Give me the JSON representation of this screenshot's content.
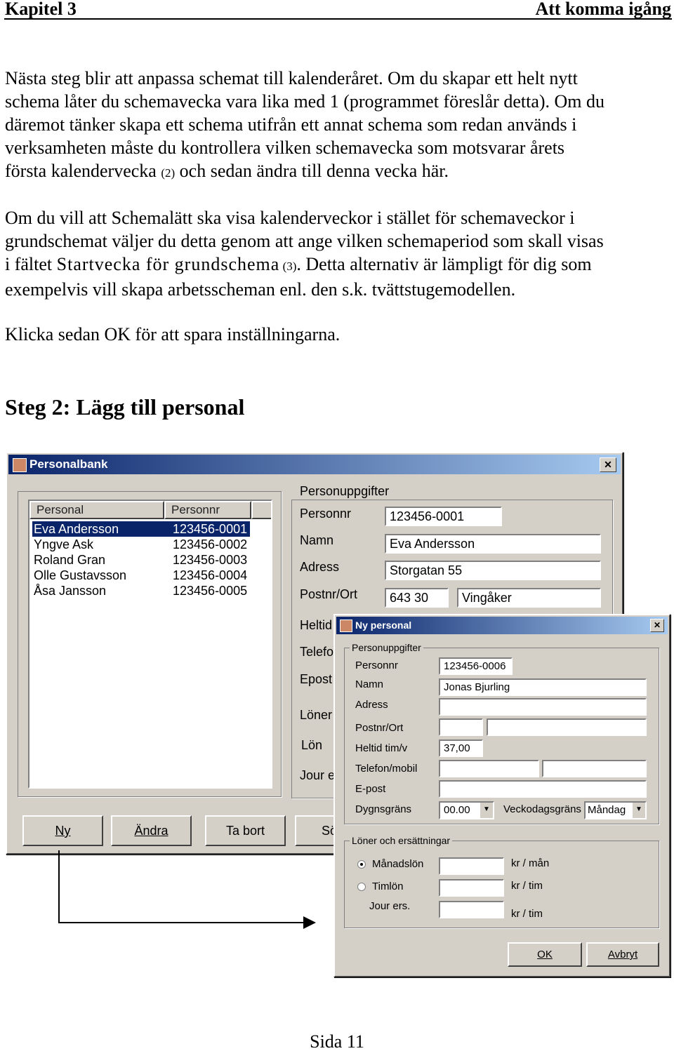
{
  "header": {
    "chapter": "Kapitel 3",
    "section": "Att komma igång"
  },
  "paragraphs": {
    "p1": [
      "Nästa steg blir att anpassa schemat till kalenderåret. Om du skapar ett helt nytt",
      "schema låter du schemavecka vara lika med 1 (programmet föreslår detta). Om du",
      "däremot tänker skapa ett schema utifrån ett annat schema som redan används i",
      "verksamheten måste du kontrollera vilken schemavecka som motsvarar årets"
    ],
    "p1_last_a": "första kalendervecka ",
    "p1_last_ref": "(2)",
    "p1_last_b": " och sedan ändra till denna vecka här.",
    "p2": [
      "Om du vill att Schemalätt ska visa kalenderveckor i stället för schemaveckor i",
      "grundschemat väljer du detta genom att ange vilken schemaperiod som skall visas"
    ],
    "p2_l3_a": "i fältet ",
    "p2_l3_field": "Startvecka för grundschema",
    "p2_l3_ref": " (3)",
    "p2_l3_b": ". Detta alternativ är lämpligt för dig som",
    "p2_l4": "exempelvis vill skapa arbetsscheman enl. den s.k. tvättstugemodellen.",
    "p3": "Klicka sedan OK för att spara inställningarna."
  },
  "heading": "Steg 2: Lägg till personal",
  "personalbank": {
    "title": "Personalbank",
    "close": "✕",
    "list_headers": [
      "Personal",
      "Personnr"
    ],
    "rows": [
      [
        "Eva Andersson",
        "123456-0001"
      ],
      [
        "Yngve Ask",
        "123456-0002"
      ],
      [
        "Roland Gran",
        "123456-0003"
      ],
      [
        "Olle Gustavsson",
        "123456-0004"
      ],
      [
        "Åsa Jansson",
        "123456-0005"
      ]
    ],
    "group": "Personuppgifter",
    "labels": {
      "personnr": "Personnr",
      "namn": "Namn",
      "adress": "Adress",
      "postnr": "Postnr/Ort",
      "heltid": "Heltid",
      "telefon": "Telefo",
      "epost": "Epost",
      "loner": "Löner",
      "lon": "Lön",
      "jour": "Jour e"
    },
    "values": {
      "personnr": "123456-0001",
      "namn": "Eva Andersson",
      "adress": "Storgatan 55",
      "postnr": "643 30",
      "ort": "Vingåker"
    },
    "buttons": {
      "ny": "Ny",
      "andra": "Ändra",
      "tabort": "Ta bort",
      "s": "Sö"
    }
  },
  "ny_personal": {
    "title": "Ny personal",
    "close": "✕",
    "group1": "Personuppgifter",
    "labels": {
      "personnr": "Personnr",
      "namn": "Namn",
      "adress": "Adress",
      "postnr": "Postnr/Ort",
      "heltid": "Heltid tim/v",
      "telefon": "Telefon/mobil",
      "epost": "E-post",
      "dygn": "Dygnsgräns",
      "vecko": "Veckodagsgräns"
    },
    "values": {
      "personnr": "123456-0006",
      "namn": "Jonas Bjurling",
      "adress": "",
      "postnr": "",
      "ort": "",
      "heltid": "37,00",
      "telefon": "",
      "mobil": "",
      "epost": "",
      "dygn": "00.00",
      "vecko": "Måndag"
    },
    "group2": "Löner och ersättningar",
    "radio_manad": "Månadslön",
    "radio_tim": "Timlön",
    "jour": "Jour ers.",
    "unit_manad": "kr / mån",
    "unit_tim": "kr / tim",
    "unit_jour": "kr / tim",
    "selected_pay": "Månadslön",
    "ok": "OK",
    "avbryt": "Avbryt"
  },
  "footer": "Sida 11"
}
